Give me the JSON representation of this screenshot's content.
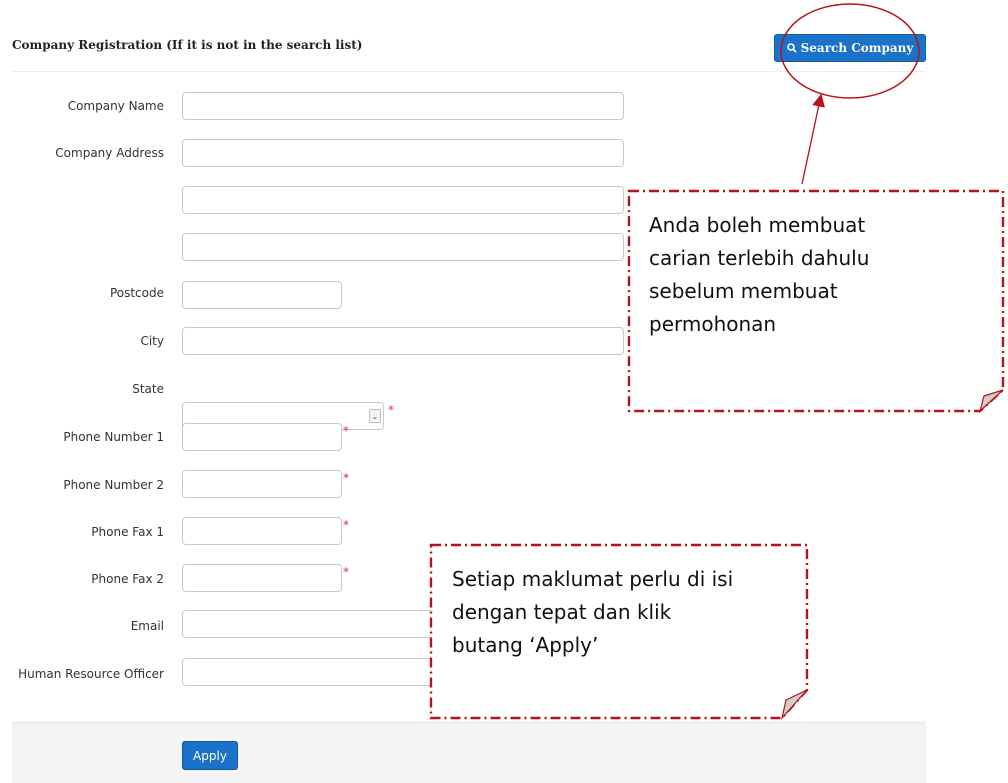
{
  "header": {
    "title": "Company Registration (If it is not in the search list)",
    "search_button_label": "Search Company"
  },
  "form": {
    "labels": {
      "company_name": "Company Name",
      "company_address": "Company Address",
      "postcode": "Postcode",
      "city": "City",
      "state": "State",
      "phone1": "Phone Number 1",
      "phone2": "Phone Number 2",
      "fax1": "Phone Fax 1",
      "fax2": "Phone Fax 2",
      "email": "Email",
      "hr_officer": "Human Resource Officer"
    },
    "values": {
      "company_name": "",
      "address1": "",
      "address2": "",
      "address3": "",
      "postcode": "",
      "city": "",
      "state": "",
      "phone1": "",
      "phone2": "",
      "fax1": "",
      "fax2": "",
      "email": "",
      "hr_officer": ""
    },
    "required_marker": "*",
    "apply_label": "Apply"
  },
  "callouts": {
    "search_tip": {
      "line1": "Anda boleh membuat",
      "line2": "carian terlebih dahulu",
      "line3": "sebelum membuat",
      "line4": "permohonan"
    },
    "apply_tip": {
      "line1": "Setiap maklumat perlu di isi",
      "line2": "dengan tepat dan klik",
      "line3": "butang ‘Apply’"
    }
  },
  "colors": {
    "primary_button": "#1a72c9",
    "annotation": "#b5121b",
    "required": "#e23030"
  },
  "icons": {
    "search_button": "search-icon",
    "state_dropdown": "chevron-down-icon"
  }
}
